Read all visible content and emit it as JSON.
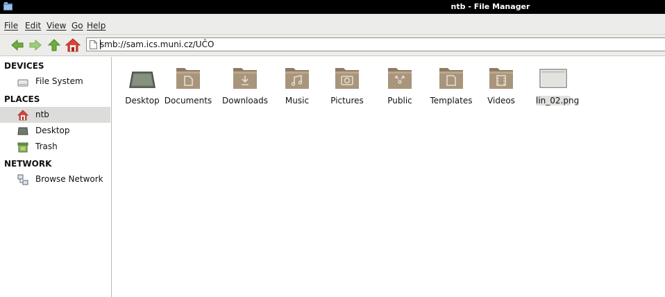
{
  "window": {
    "title": "ntb - File Manager"
  },
  "menu": [
    "File",
    "Edit",
    "View",
    "Go",
    "Help"
  ],
  "address": {
    "value": "smb://sam.ics.muni.cz/UČO"
  },
  "sidebar": {
    "devices_heading": "DEVICES",
    "devices": [
      {
        "label": "File System",
        "icon": "drive-icon"
      }
    ],
    "places_heading": "PLACES",
    "places": [
      {
        "label": "ntb",
        "icon": "home-icon",
        "selected": true
      },
      {
        "label": "Desktop",
        "icon": "desktop-icon"
      },
      {
        "label": "Trash",
        "icon": "trash-icon"
      }
    ],
    "network_heading": "NETWORK",
    "network": [
      {
        "label": "Browse Network",
        "icon": "network-icon"
      }
    ]
  },
  "files": [
    {
      "name": "Desktop",
      "icon": "desktop-folder-icon"
    },
    {
      "name": "Documents",
      "icon": "documents-folder-icon"
    },
    {
      "name": "Downloads",
      "icon": "downloads-folder-icon"
    },
    {
      "name": "Music",
      "icon": "music-folder-icon"
    },
    {
      "name": "Pictures",
      "icon": "pictures-folder-icon"
    },
    {
      "name": "Public",
      "icon": "public-folder-icon"
    },
    {
      "name": "Templates",
      "icon": "templates-folder-icon"
    },
    {
      "name": "Videos",
      "icon": "videos-folder-icon"
    },
    {
      "name": "lin_02.png",
      "icon": "image-file-icon",
      "selected": true
    }
  ],
  "colors": {
    "titlebar": "#000000",
    "folder": "#a9957c",
    "menubar": "#ececea",
    "selection": "#dcdcda"
  }
}
